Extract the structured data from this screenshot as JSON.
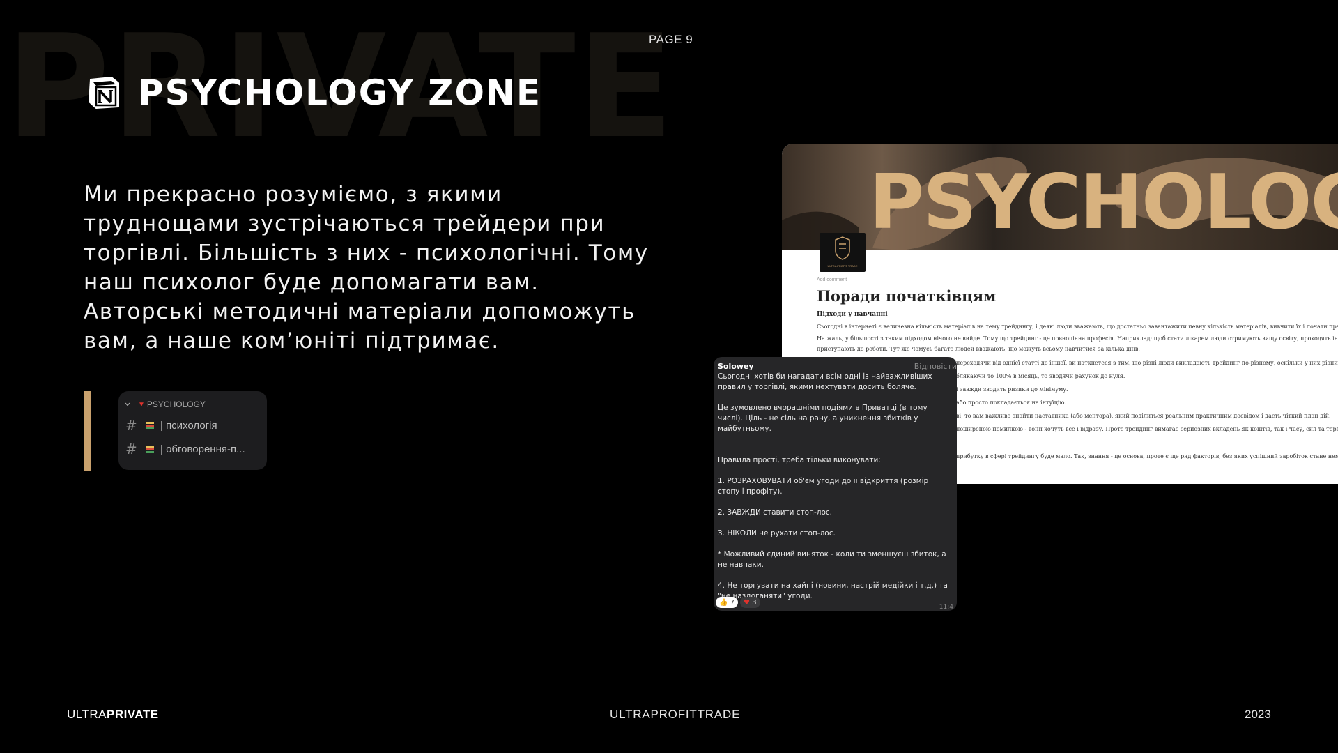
{
  "background_word": "PRIVATE",
  "page_number": "PAGE 9",
  "title": "PSYCHOLOGY ZONE",
  "paragraph": "Ми прекрасно розуміємо, з якими труднощами зустрічаються трейдери при торгівлі. Більшість з них - психологічні. Тому наш психолог буде допомагати вам. Авторські методичні матеріали допоможуть вам, а наше ком’юніті підтримає.",
  "channels": {
    "category": "PSYCHOLOGY",
    "items": [
      {
        "label": "| психологія"
      },
      {
        "label": "| обговорення-п..."
      }
    ]
  },
  "notion": {
    "cover_word": "PSYCHOLOG",
    "brand_text": "ULTRA PROFIT TRADE",
    "add_comment": "Add comment",
    "page_title": "Поради початківцям",
    "subtitle": "Підходи у навчанні",
    "lines": [
      "Сьогодні в інтернеті є величезна кількість матеріалів на тему трейдингу, і деякі люди вважають, що достатньо завантажити певну кількість матеріалів, вивчити їх і почати працю",
      "На жаль, у більшості з таким підходом нічого не вийде. Тому що трейдинг - це повноцінна професія. Наприклад: щоб стати лікарем люди отримують вищу освіту, проходять інте",
      "приступають до роботи. Тут же чомусь багато людей вважають, що можуть всьому навчитися за кілька днів.",
      "переходячи від однієї статті до іншої, ви наткнетеся з тим, що різні люди викладають трейдинг по-різному, оскільки у них різний пі",
      "блякаючи то 100% в місяць, то зводячи рахунок до нуля.",
      "і завжди зводить ризики до мінімуму.",
      "або просто покладається на інтуїцію.",
      "ві, то вам важливо знайти наставника (або ментора), який поділиться реальним практичним досвідом і дасть чіткий план дій.",
      "поширеною помилкою - вони хочуть все і відразу. Проте трейдинг вимагає серйозних вкладень як коштів, так і часу, сил та терпін",
      "прибутку в сфері трейдингу буде мало. Так, знання - це основа, проте є ще ряд факторів, без яких успішний заробіток стане неможл"
    ]
  },
  "telegram": {
    "author": "Solowey",
    "reply": "Відповісти",
    "paragraphs": [
      "Сьогодні хотів би нагадати всім одні із найважливіших правил у торгівлі, якими нехтувати досить боляче.",
      "Це зумовлено вчорашніми подіями в Приватці (в тому числі). Ціль - не сіль на рану, а уникнення збитків у майбутньому.",
      "Правила прості, треба тільки виконувати:",
      "1. РОЗРАХОВУВАТИ об'єм угоди до її відкриття (розмір стопу і профіту).",
      "2. ЗАВЖДИ ставити стоп-лос.",
      "3. НІКОЛИ не рухати стоп-лос.",
      "* Можливий єдиний виняток - коли ти зменшуєш збиток, а не навпаки.",
      "4. Не торгувати на хайпі (новини, настрій медійки і т.д.) та \"не наздоганяти\" угоди."
    ],
    "reactions": [
      {
        "emoji": "👍",
        "count": "7"
      },
      {
        "emoji": "♥",
        "count": "3"
      }
    ],
    "time": "11:4"
  },
  "footer": {
    "left_light": "ULTRA",
    "left_bold": "PRIVATE",
    "center": "ULTRAPROFITTRADE",
    "right": "2023"
  },
  "colors": {
    "gold": "#c9a16d",
    "background": "#000000"
  }
}
